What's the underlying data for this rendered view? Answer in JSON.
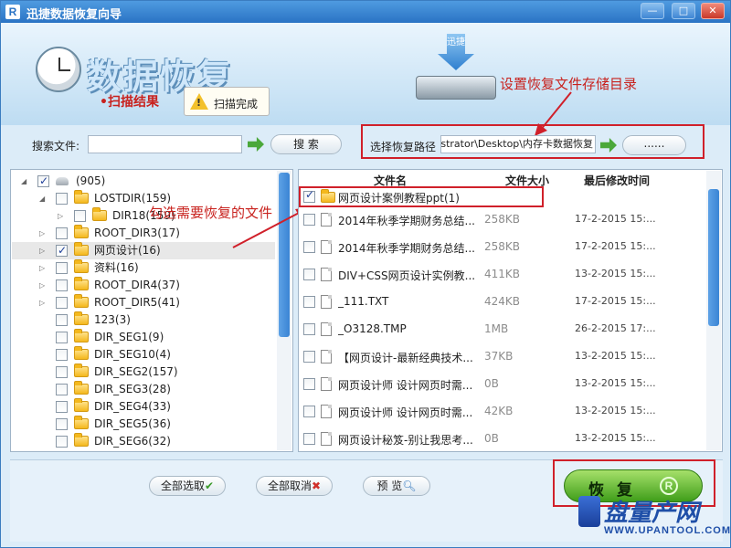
{
  "window": {
    "title": "迅捷数据恢复向导",
    "minimize": "—",
    "maximize": "□",
    "close": "✕"
  },
  "header": {
    "title": "数据恢复",
    "scan_result": "•扫描结果",
    "scan_tip": "扫描完成",
    "drive_text": "迅捷"
  },
  "annotations": {
    "storage_dir": "设置恢复文件存储目录",
    "select_files": "勾选需要恢复的文件"
  },
  "search": {
    "label": "搜索文件:",
    "value": "",
    "button": "搜 索"
  },
  "recovery_path": {
    "label": "选择恢复路径",
    "value": "C:\\Users\\Administrator\\Desktop\\内存卡数据恢复",
    "browse_button": "......"
  },
  "tree": {
    "items": [
      {
        "label": "(905)",
        "checked": true,
        "expander": "◢",
        "icon": "drive-icon"
      },
      {
        "label": "LOSTDIR(159)",
        "checked": false,
        "expander": "◢",
        "icon": "folder-icon"
      },
      {
        "label": "DIR18(159)",
        "checked": false,
        "expander": "▷",
        "icon": "folder-icon"
      },
      {
        "label": "ROOT_DIR3(17)",
        "checked": false,
        "expander": "▷",
        "icon": "folder-icon"
      },
      {
        "label": "网页设计(16)",
        "checked": true,
        "expander": "▷",
        "icon": "folder-icon"
      },
      {
        "label": "资料(16)",
        "checked": false,
        "expander": "▷",
        "icon": "folder-icon"
      },
      {
        "label": "ROOT_DIR4(37)",
        "checked": false,
        "expander": "▷",
        "icon": "folder-icon"
      },
      {
        "label": "ROOT_DIR5(41)",
        "checked": false,
        "expander": "▷",
        "icon": "folder-icon"
      },
      {
        "label": "123(3)",
        "checked": false,
        "expander": "",
        "icon": "folder-icon"
      },
      {
        "label": "DIR_SEG1(9)",
        "checked": false,
        "expander": "",
        "icon": "folder-icon"
      },
      {
        "label": "DIR_SEG10(4)",
        "checked": false,
        "expander": "",
        "icon": "folder-icon"
      },
      {
        "label": "DIR_SEG2(157)",
        "checked": false,
        "expander": "",
        "icon": "folder-icon"
      },
      {
        "label": "DIR_SEG3(28)",
        "checked": false,
        "expander": "",
        "icon": "folder-icon"
      },
      {
        "label": "DIR_SEG4(33)",
        "checked": false,
        "expander": "",
        "icon": "folder-icon"
      },
      {
        "label": "DIR_SEG5(36)",
        "checked": false,
        "expander": "",
        "icon": "folder-icon"
      },
      {
        "label": "DIR_SEG6(32)",
        "checked": false,
        "expander": "",
        "icon": "folder-icon"
      }
    ]
  },
  "files": {
    "columns": [
      "文件名",
      "文件大小",
      "最后修改时间"
    ],
    "rows": [
      {
        "name": "网页设计案例教程ppt(1)",
        "size": "",
        "modified": "",
        "checked": true,
        "icon": "folder-icon"
      },
      {
        "name": "2014年秋季学期财务总结...",
        "size": "258KB",
        "modified": "17-2-2015 15:...",
        "checked": false,
        "icon": "file-icon"
      },
      {
        "name": "2014年秋季学期财务总结...",
        "size": "258KB",
        "modified": "17-2-2015 15:...",
        "checked": false,
        "icon": "file-icon"
      },
      {
        "name": "DIV+CSS网页设计实例教...",
        "size": "411KB",
        "modified": "13-2-2015 15:...",
        "checked": false,
        "icon": "file-icon"
      },
      {
        "name": "_111.TXT",
        "size": "424KB",
        "modified": "17-2-2015 15:...",
        "checked": false,
        "icon": "file-icon"
      },
      {
        "name": "_O3128.TMP",
        "size": "1MB",
        "modified": "26-2-2015 17:...",
        "checked": false,
        "icon": "file-icon"
      },
      {
        "name": "【网页设计-最新经典技术...",
        "size": "37KB",
        "modified": "13-2-2015 15:...",
        "checked": false,
        "icon": "file-icon"
      },
      {
        "name": "网页设计师 设计网页时需...",
        "size": "0B",
        "modified": "13-2-2015 15:...",
        "checked": false,
        "icon": "file-icon"
      },
      {
        "name": "网页设计师 设计网页时需...",
        "size": "42KB",
        "modified": "13-2-2015 15:...",
        "checked": false,
        "icon": "file-icon"
      },
      {
        "name": "网页设计秘笈-别让我思考...",
        "size": "0B",
        "modified": "13-2-2015 15:...",
        "checked": false,
        "icon": "file-icon"
      }
    ]
  },
  "actions": {
    "select_all": "全部选取",
    "deselect_all": "全部取消",
    "preview": "预 览",
    "recover": "恢复",
    "recover_badge": "R"
  },
  "watermark": {
    "title": "盘量产网",
    "url": "WWW.UPANTOOL.COM"
  }
}
